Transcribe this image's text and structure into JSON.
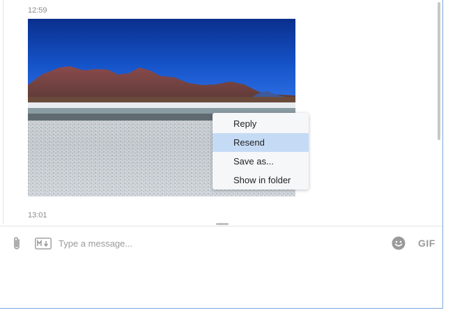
{
  "messages": [
    {
      "time": "12:59"
    },
    {
      "time": "13:01"
    }
  ],
  "context_menu": {
    "items": [
      {
        "label": "Reply",
        "highlighted": false
      },
      {
        "label": "Resend",
        "highlighted": true
      },
      {
        "label": "Save as...",
        "highlighted": false
      },
      {
        "label": "Show in folder",
        "highlighted": false
      }
    ],
    "highlight_color": "#c5dbf5"
  },
  "composer": {
    "placeholder": "Type a message...",
    "gif_label": "GIF",
    "attach_icon": "paperclip-icon",
    "markdown_icon": "markdown-icon",
    "emoji_icon": "emoji-icon"
  },
  "colors": {
    "window_border": "#7aa7e0",
    "sky": "#0b3fa6",
    "muted_text": "#8a8a8a"
  }
}
